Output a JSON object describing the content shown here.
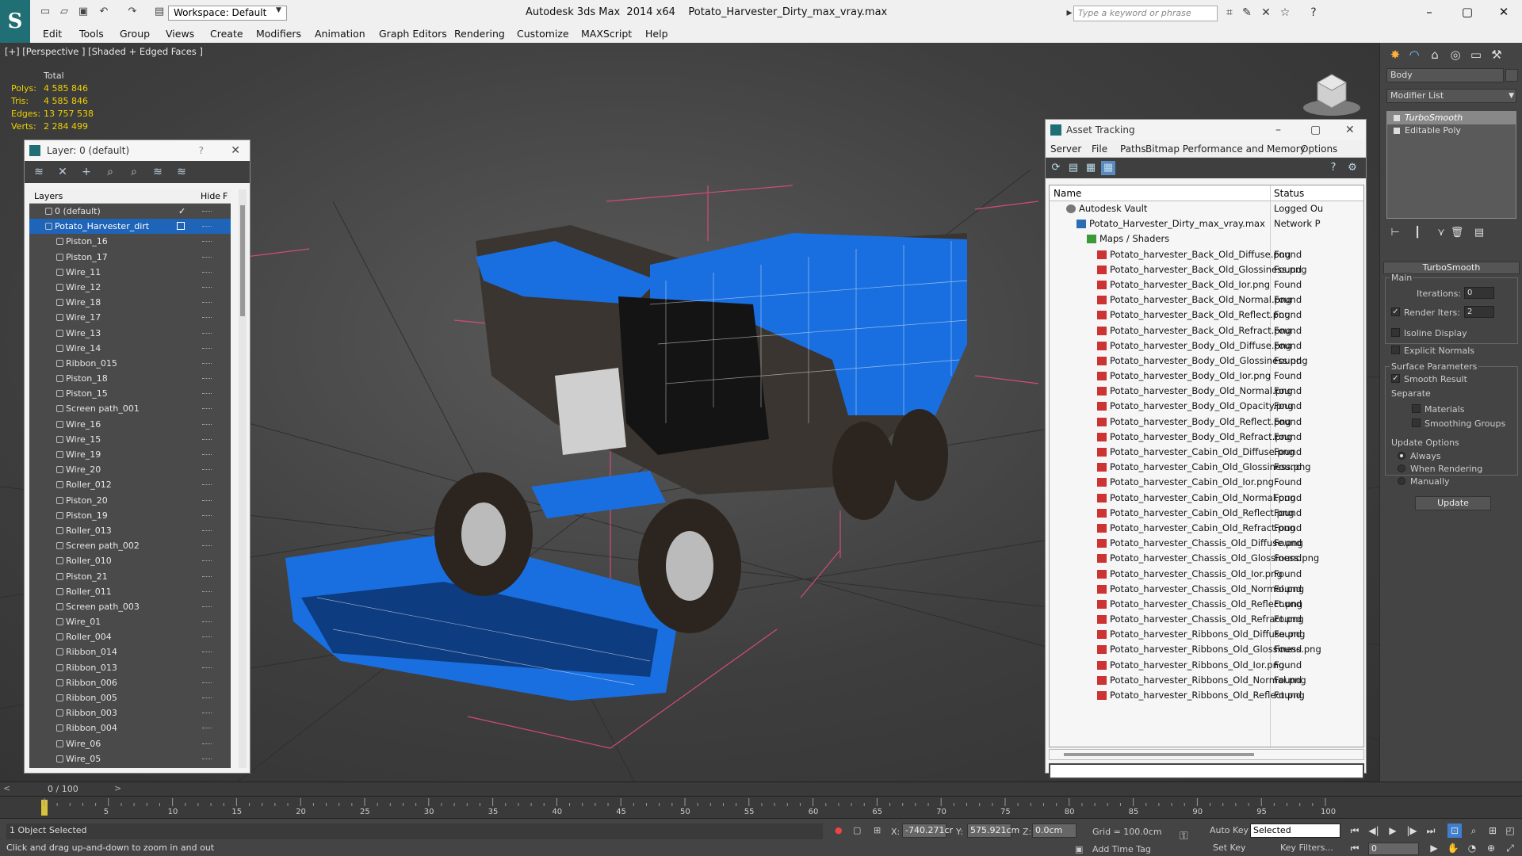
{
  "titlebar": {
    "workspace": "Workspace: Default",
    "app_name": "Autodesk 3ds Max  2014 x64",
    "file_name": "Potato_Harvester_Dirty_max_vray.max",
    "search_placeholder": "Type a keyword or phrase"
  },
  "menu": [
    "Edit",
    "Tools",
    "Group",
    "Views",
    "Create",
    "Modifiers",
    "Animation",
    "Graph Editors",
    "Rendering",
    "Customize",
    "MAXScript",
    "Help"
  ],
  "viewport": {
    "label": "[+] [Perspective ] [Shaded + Edged Faces ]",
    "stats": {
      "total_label": "Total",
      "polys_label": "Polys:",
      "polys": "4 585 846",
      "tris_label": "Tris:",
      "tris": "4 585 846",
      "edges_label": "Edges:",
      "edges": "13 757 538",
      "verts_label": "Verts:",
      "verts": "2 284 499"
    },
    "model_color": "#1a6fe0"
  },
  "layer_panel": {
    "title": "Layer: 0 (default)",
    "help": "?",
    "col_layers": "Layers",
    "col_hide": "Hide",
    "col_f": "F",
    "rows": [
      {
        "name": "0 (default)",
        "level": "top"
      },
      {
        "name": "Potato_Harvester_dirt",
        "level": "sel"
      },
      {
        "name": "Piston_16"
      },
      {
        "name": "Piston_17"
      },
      {
        "name": "Wire_11"
      },
      {
        "name": "Wire_12"
      },
      {
        "name": "Wire_18"
      },
      {
        "name": "Wire_17"
      },
      {
        "name": "Wire_13"
      },
      {
        "name": "Wire_14"
      },
      {
        "name": "Ribbon_015"
      },
      {
        "name": "Piston_18"
      },
      {
        "name": "Piston_15"
      },
      {
        "name": "Screen path_001"
      },
      {
        "name": "Wire_16"
      },
      {
        "name": "Wire_15"
      },
      {
        "name": "Wire_19"
      },
      {
        "name": "Wire_20"
      },
      {
        "name": "Roller_012"
      },
      {
        "name": "Piston_20"
      },
      {
        "name": "Piston_19"
      },
      {
        "name": "Roller_013"
      },
      {
        "name": "Screen path_002"
      },
      {
        "name": "Roller_010"
      },
      {
        "name": "Piston_21"
      },
      {
        "name": "Roller_011"
      },
      {
        "name": "Screen path_003"
      },
      {
        "name": "Wire_01"
      },
      {
        "name": "Roller_004"
      },
      {
        "name": "Ribbon_014"
      },
      {
        "name": "Ribbon_013"
      },
      {
        "name": "Ribbon_006"
      },
      {
        "name": "Ribbon_005"
      },
      {
        "name": "Ribbon_003"
      },
      {
        "name": "Ribbon_004"
      },
      {
        "name": "Wire_06"
      },
      {
        "name": "Wire_05"
      }
    ]
  },
  "asset_panel": {
    "title": "Asset Tracking",
    "menu": [
      "Server",
      "File",
      "Paths",
      "Bitmap Performance and Memory",
      "Options"
    ],
    "col_name": "Name",
    "col_status": "Status",
    "rows": [
      {
        "name": "Autodesk Vault",
        "status": "Logged Ou",
        "indent": 1,
        "icon": "vault"
      },
      {
        "name": "Potato_Harvester_Dirty_max_vray.max",
        "status": "Network P",
        "indent": 2,
        "icon": "max"
      },
      {
        "name": "Maps / Shaders",
        "status": "",
        "indent": 3,
        "icon": "fold"
      },
      {
        "name": "Potato_harvester_Back_Old_Diffuse.png",
        "status": "Found",
        "indent": 4,
        "icon": "png"
      },
      {
        "name": "Potato_harvester_Back_Old_Glossiness.png",
        "status": "Found",
        "indent": 4,
        "icon": "png"
      },
      {
        "name": "Potato_harvester_Back_Old_Ior.png",
        "status": "Found",
        "indent": 4,
        "icon": "png"
      },
      {
        "name": "Potato_harvester_Back_Old_Normal.png",
        "status": "Found",
        "indent": 4,
        "icon": "png"
      },
      {
        "name": "Potato_harvester_Back_Old_Reflect.png",
        "status": "Found",
        "indent": 4,
        "icon": "png"
      },
      {
        "name": "Potato_harvester_Back_Old_Refract.png",
        "status": "Found",
        "indent": 4,
        "icon": "png"
      },
      {
        "name": "Potato_harvester_Body_Old_Diffuse.png",
        "status": "Found",
        "indent": 4,
        "icon": "png"
      },
      {
        "name": "Potato_harvester_Body_Old_Glossiness.png",
        "status": "Found",
        "indent": 4,
        "icon": "png"
      },
      {
        "name": "Potato_harvester_Body_Old_Ior.png",
        "status": "Found",
        "indent": 4,
        "icon": "png"
      },
      {
        "name": "Potato_harvester_Body_Old_Normal.png",
        "status": "Found",
        "indent": 4,
        "icon": "png"
      },
      {
        "name": "Potato_harvester_Body_Old_Opacity.png",
        "status": "Found",
        "indent": 4,
        "icon": "png"
      },
      {
        "name": "Potato_harvester_Body_Old_Reflect.png",
        "status": "Found",
        "indent": 4,
        "icon": "png"
      },
      {
        "name": "Potato_harvester_Body_Old_Refract.png",
        "status": "Found",
        "indent": 4,
        "icon": "png"
      },
      {
        "name": "Potato_harvester_Cabin_Old_Diffuse.png",
        "status": "Found",
        "indent": 4,
        "icon": "png"
      },
      {
        "name": "Potato_harvester_Cabin_Old_Glossiness.png",
        "status": "Found",
        "indent": 4,
        "icon": "png"
      },
      {
        "name": "Potato_harvester_Cabin_Old_Ior.png",
        "status": "Found",
        "indent": 4,
        "icon": "png"
      },
      {
        "name": "Potato_harvester_Cabin_Old_Normal.png",
        "status": "Found",
        "indent": 4,
        "icon": "png"
      },
      {
        "name": "Potato_harvester_Cabin_Old_Reflect.png",
        "status": "Found",
        "indent": 4,
        "icon": "png"
      },
      {
        "name": "Potato_harvester_Cabin_Old_Refract.png",
        "status": "Found",
        "indent": 4,
        "icon": "png"
      },
      {
        "name": "Potato_harvester_Chassis_Old_Diffuse.png",
        "status": "Found",
        "indent": 4,
        "icon": "png"
      },
      {
        "name": "Potato_harvester_Chassis_Old_Glossiness.png",
        "status": "Found",
        "indent": 4,
        "icon": "png"
      },
      {
        "name": "Potato_harvester_Chassis_Old_Ior.png",
        "status": "Found",
        "indent": 4,
        "icon": "png"
      },
      {
        "name": "Potato_harvester_Chassis_Old_Normal.png",
        "status": "Found",
        "indent": 4,
        "icon": "png"
      },
      {
        "name": "Potato_harvester_Chassis_Old_Reflect.png",
        "status": "Found",
        "indent": 4,
        "icon": "png"
      },
      {
        "name": "Potato_harvester_Chassis_Old_Refract.png",
        "status": "Found",
        "indent": 4,
        "icon": "png"
      },
      {
        "name": "Potato_harvester_Ribbons_Old_Diffuse.png",
        "status": "Found",
        "indent": 4,
        "icon": "png"
      },
      {
        "name": "Potato_harvester_Ribbons_Old_Glossiness.png",
        "status": "Found",
        "indent": 4,
        "icon": "png"
      },
      {
        "name": "Potato_harvester_Ribbons_Old_Ior.png",
        "status": "Found",
        "indent": 4,
        "icon": "png"
      },
      {
        "name": "Potato_harvester_Ribbons_Old_Normal.png",
        "status": "Found",
        "indent": 4,
        "icon": "png"
      },
      {
        "name": "Potato_harvester_Ribbons_Old_Reflect.png",
        "status": "Found",
        "indent": 4,
        "icon": "png"
      }
    ]
  },
  "command_panel": {
    "object_name": "Body",
    "modifier_list": "Modifier List",
    "stack": [
      "TurboSmooth",
      "Editable Poly"
    ],
    "rollout": "TurboSmooth",
    "main_label": "Main",
    "iterations_label": "Iterations:",
    "iterations": "0",
    "render_iters_label": "Render Iters:",
    "render_iters": "2",
    "isoline": "Isoline Display",
    "explicit_normals": "Explicit Normals",
    "surface_params": "Surface Parameters",
    "smooth_result": "Smooth Result",
    "separate": "Separate",
    "materials": "Materials",
    "smoothing_groups": "Smoothing Groups",
    "update_options": "Update Options",
    "always": "Always",
    "when_rendering": "When Rendering",
    "manually": "Manually",
    "update_btn": "Update"
  },
  "timeline": {
    "frame_label": "0 / 100",
    "ticks": [
      "5",
      "10",
      "15",
      "20",
      "25",
      "30",
      "35",
      "40",
      "45",
      "50",
      "55",
      "60",
      "65",
      "70",
      "75",
      "80",
      "85",
      "90",
      "95",
      "100"
    ]
  },
  "status": {
    "selected": "1 Object Selected",
    "prompt": "Click and drag up-and-down to zoom in and out",
    "x_label": "X:",
    "x": "-740.271cr",
    "y_label": "Y:",
    "y": "575.921cm",
    "z_label": "Z:",
    "z": "0.0cm",
    "grid": "Grid = 100.0cm",
    "add_time_tag": "Add Time Tag",
    "auto_key": "Auto Key",
    "set_key": "Set Key",
    "selection_set": "Selected",
    "key_filters": "Key Filters...",
    "frame": "0"
  }
}
